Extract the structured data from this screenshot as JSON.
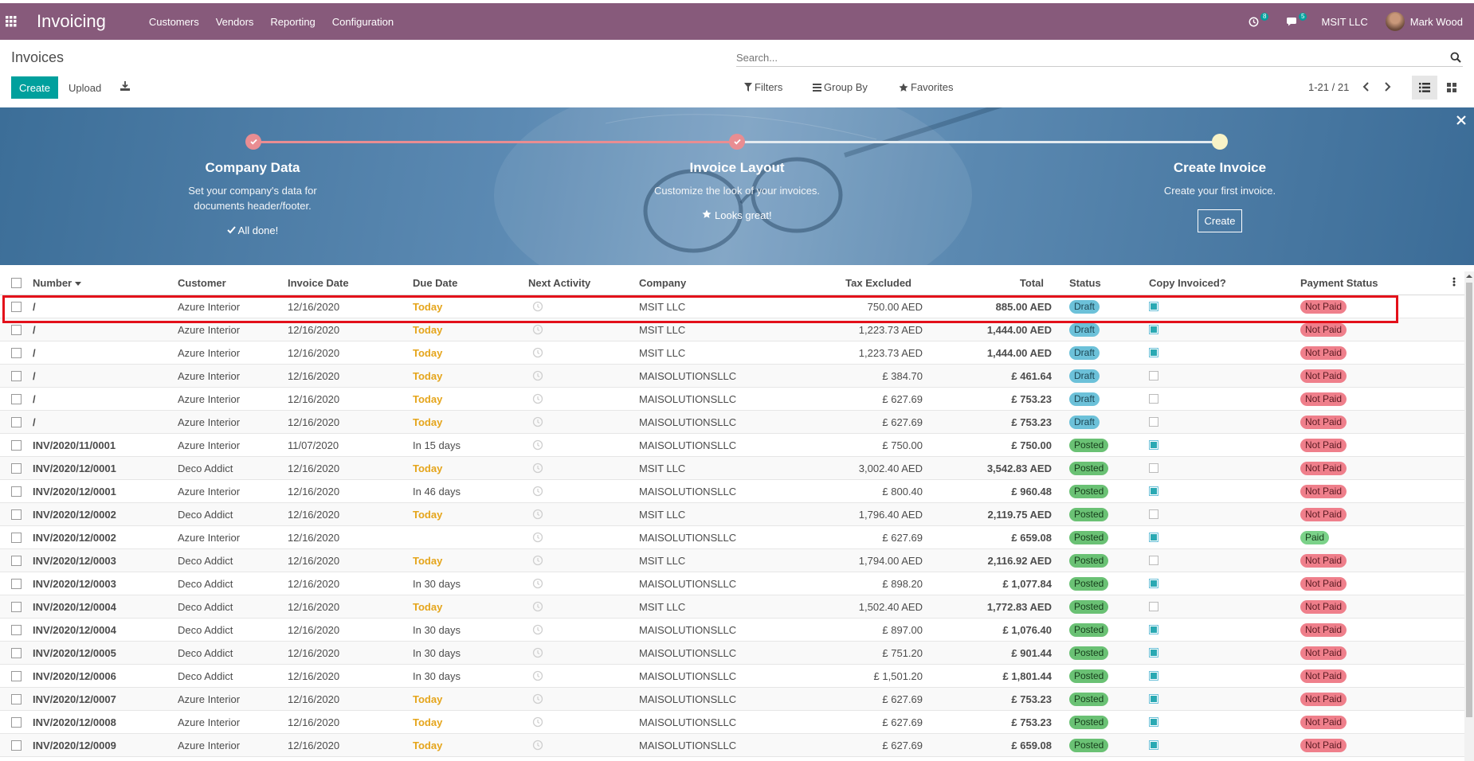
{
  "navbar": {
    "brand": "Invoicing",
    "menu": [
      "Customers",
      "Vendors",
      "Reporting",
      "Configuration"
    ],
    "activity_count": "8",
    "message_count": "5",
    "company": "MSIT LLC",
    "user": "Mark Wood"
  },
  "control": {
    "title": "Invoices",
    "search_placeholder": "Search...",
    "create_label": "Create",
    "upload_label": "Upload",
    "filters_label": "Filters",
    "groupby_label": "Group By",
    "favorites_label": "Favorites",
    "pager": "1-21 / 21"
  },
  "banner": {
    "steps": [
      {
        "title": "Company Data",
        "desc": "Set your company's data for documents header/footer.",
        "status": "All done!"
      },
      {
        "title": "Invoice Layout",
        "desc": "Customize the look of your invoices.",
        "status": "Looks great!"
      },
      {
        "title": "Create Invoice",
        "desc": "Create your first invoice.",
        "button": "Create"
      }
    ]
  },
  "table": {
    "headers": {
      "number": "Number",
      "customer": "Customer",
      "invoice_date": "Invoice Date",
      "due_date": "Due Date",
      "next_activity": "Next Activity",
      "company": "Company",
      "tax_excluded": "Tax Excluded",
      "total": "Total",
      "status": "Status",
      "copy_invoiced": "Copy Invoiced?",
      "payment_status": "Payment Status"
    },
    "rows": [
      {
        "number": "/",
        "customer": "Azure Interior",
        "idate": "12/16/2020",
        "ddate": "Today",
        "company": "MSIT LLC",
        "tax": "750.00 AED",
        "total": "885.00 AED",
        "status": "Draft",
        "copy": true,
        "pay": "Not Paid"
      },
      {
        "number": "/",
        "customer": "Azure Interior",
        "idate": "12/16/2020",
        "ddate": "Today",
        "company": "MSIT LLC",
        "tax": "1,223.73 AED",
        "total": "1,444.00 AED",
        "status": "Draft",
        "copy": true,
        "pay": "Not Paid"
      },
      {
        "number": "/",
        "customer": "Azure Interior",
        "idate": "12/16/2020",
        "ddate": "Today",
        "company": "MSIT LLC",
        "tax": "1,223.73 AED",
        "total": "1,444.00 AED",
        "status": "Draft",
        "copy": true,
        "pay": "Not Paid"
      },
      {
        "number": "/",
        "customer": "Azure Interior",
        "idate": "12/16/2020",
        "ddate": "Today",
        "company": "MAISOLUTIONSLLC",
        "tax": "£ 384.70",
        "total": "£ 461.64",
        "status": "Draft",
        "copy": false,
        "pay": "Not Paid"
      },
      {
        "number": "/",
        "customer": "Azure Interior",
        "idate": "12/16/2020",
        "ddate": "Today",
        "company": "MAISOLUTIONSLLC",
        "tax": "£ 627.69",
        "total": "£ 753.23",
        "status": "Draft",
        "copy": false,
        "pay": "Not Paid"
      },
      {
        "number": "/",
        "customer": "Azure Interior",
        "idate": "12/16/2020",
        "ddate": "Today",
        "company": "MAISOLUTIONSLLC",
        "tax": "£ 627.69",
        "total": "£ 753.23",
        "status": "Draft",
        "copy": false,
        "pay": "Not Paid"
      },
      {
        "number": "INV/2020/11/0001",
        "customer": "Azure Interior",
        "idate": "11/07/2020",
        "ddate": "In 15 days",
        "company": "MAISOLUTIONSLLC",
        "tax": "£ 750.00",
        "total": "£ 750.00",
        "status": "Posted",
        "copy": true,
        "pay": "Not Paid"
      },
      {
        "number": "INV/2020/12/0001",
        "customer": "Deco Addict",
        "idate": "12/16/2020",
        "ddate": "Today",
        "company": "MSIT LLC",
        "tax": "3,002.40 AED",
        "total": "3,542.83 AED",
        "status": "Posted",
        "copy": false,
        "pay": "Not Paid"
      },
      {
        "number": "INV/2020/12/0001",
        "customer": "Azure Interior",
        "idate": "12/16/2020",
        "ddate": "In 46 days",
        "company": "MAISOLUTIONSLLC",
        "tax": "£ 800.40",
        "total": "£ 960.48",
        "status": "Posted",
        "copy": true,
        "pay": "Not Paid"
      },
      {
        "number": "INV/2020/12/0002",
        "customer": "Deco Addict",
        "idate": "12/16/2020",
        "ddate": "Today",
        "company": "MSIT LLC",
        "tax": "1,796.40 AED",
        "total": "2,119.75 AED",
        "status": "Posted",
        "copy": false,
        "pay": "Not Paid"
      },
      {
        "number": "INV/2020/12/0002",
        "customer": "Azure Interior",
        "idate": "12/16/2020",
        "ddate": "",
        "company": "MAISOLUTIONSLLC",
        "tax": "£ 627.69",
        "total": "£ 659.08",
        "status": "Posted",
        "copy": true,
        "pay": "Paid"
      },
      {
        "number": "INV/2020/12/0003",
        "customer": "Deco Addict",
        "idate": "12/16/2020",
        "ddate": "Today",
        "company": "MSIT LLC",
        "tax": "1,794.00 AED",
        "total": "2,116.92 AED",
        "status": "Posted",
        "copy": false,
        "pay": "Not Paid"
      },
      {
        "number": "INV/2020/12/0003",
        "customer": "Deco Addict",
        "idate": "12/16/2020",
        "ddate": "In 30 days",
        "company": "MAISOLUTIONSLLC",
        "tax": "£ 898.20",
        "total": "£ 1,077.84",
        "status": "Posted",
        "copy": true,
        "pay": "Not Paid"
      },
      {
        "number": "INV/2020/12/0004",
        "customer": "Deco Addict",
        "idate": "12/16/2020",
        "ddate": "Today",
        "company": "MSIT LLC",
        "tax": "1,502.40 AED",
        "total": "1,772.83 AED",
        "status": "Posted",
        "copy": false,
        "pay": "Not Paid"
      },
      {
        "number": "INV/2020/12/0004",
        "customer": "Deco Addict",
        "idate": "12/16/2020",
        "ddate": "In 30 days",
        "company": "MAISOLUTIONSLLC",
        "tax": "£ 897.00",
        "total": "£ 1,076.40",
        "status": "Posted",
        "copy": true,
        "pay": "Not Paid"
      },
      {
        "number": "INV/2020/12/0005",
        "customer": "Deco Addict",
        "idate": "12/16/2020",
        "ddate": "In 30 days",
        "company": "MAISOLUTIONSLLC",
        "tax": "£ 751.20",
        "total": "£ 901.44",
        "status": "Posted",
        "copy": true,
        "pay": "Not Paid"
      },
      {
        "number": "INV/2020/12/0006",
        "customer": "Deco Addict",
        "idate": "12/16/2020",
        "ddate": "In 30 days",
        "company": "MAISOLUTIONSLLC",
        "tax": "£ 1,501.20",
        "total": "£ 1,801.44",
        "status": "Posted",
        "copy": true,
        "pay": "Not Paid"
      },
      {
        "number": "INV/2020/12/0007",
        "customer": "Azure Interior",
        "idate": "12/16/2020",
        "ddate": "Today",
        "company": "MAISOLUTIONSLLC",
        "tax": "£ 627.69",
        "total": "£ 753.23",
        "status": "Posted",
        "copy": true,
        "pay": "Not Paid"
      },
      {
        "number": "INV/2020/12/0008",
        "customer": "Azure Interior",
        "idate": "12/16/2020",
        "ddate": "Today",
        "company": "MAISOLUTIONSLLC",
        "tax": "£ 627.69",
        "total": "£ 753.23",
        "status": "Posted",
        "copy": true,
        "pay": "Not Paid"
      },
      {
        "number": "INV/2020/12/0009",
        "customer": "Azure Interior",
        "idate": "12/16/2020",
        "ddate": "Today",
        "company": "MAISOLUTIONSLLC",
        "tax": "£ 627.69",
        "total": "£ 659.08",
        "status": "Posted",
        "copy": true,
        "pay": "Not Paid"
      }
    ]
  },
  "colors": {
    "brand": "#875a7b",
    "primary": "#00a09d",
    "today": "#e5a51b",
    "highlight": "#e3101a"
  }
}
